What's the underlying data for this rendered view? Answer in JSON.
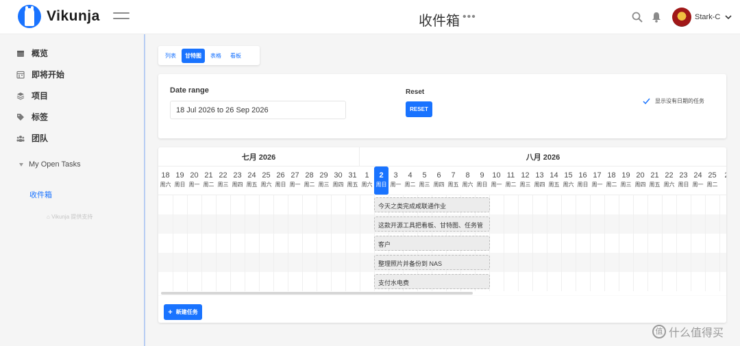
{
  "app": {
    "name": "Vikunja"
  },
  "header": {
    "title": "收件箱",
    "menu_dots": "•••",
    "username": "Stark-C"
  },
  "sidebar": {
    "items": [
      {
        "label": "概览",
        "icon": "calendar-icon"
      },
      {
        "label": "即将开始",
        "icon": "calendar-grid-icon"
      },
      {
        "label": "项目",
        "icon": "layers-icon"
      },
      {
        "label": "标签",
        "icon": "tags-icon"
      },
      {
        "label": "团队",
        "icon": "users-icon"
      }
    ],
    "project": "My Open Tasks",
    "inbox": "收件箱",
    "powered_by": "Vikunja 提供支持"
  },
  "views": {
    "tabs": [
      {
        "label": "列表",
        "active": false
      },
      {
        "label": "甘特图",
        "active": true
      },
      {
        "label": "表格",
        "active": false
      },
      {
        "label": "看板",
        "active": false
      }
    ]
  },
  "options": {
    "date_range_label": "Date range",
    "date_range_value": "18 Jul 2026 to 26 Sep 2026",
    "reset_label": "Reset",
    "reset_button": "RESET",
    "show_undated_label": "显示没有日期的任务"
  },
  "gantt": {
    "months": [
      "七月 2026",
      "八月 2026"
    ],
    "today_index": 15,
    "days": [
      {
        "num": "18",
        "wd": "周六"
      },
      {
        "num": "19",
        "wd": "周日"
      },
      {
        "num": "20",
        "wd": "周一"
      },
      {
        "num": "21",
        "wd": "周二"
      },
      {
        "num": "22",
        "wd": "周三"
      },
      {
        "num": "23",
        "wd": "周四"
      },
      {
        "num": "24",
        "wd": "周五"
      },
      {
        "num": "25",
        "wd": "周六"
      },
      {
        "num": "26",
        "wd": "周日"
      },
      {
        "num": "27",
        "wd": "周一"
      },
      {
        "num": "28",
        "wd": "周二"
      },
      {
        "num": "29",
        "wd": "周三"
      },
      {
        "num": "30",
        "wd": "周四"
      },
      {
        "num": "31",
        "wd": "周五"
      },
      {
        "num": "1",
        "wd": "周六"
      },
      {
        "num": "2",
        "wd": "周日"
      },
      {
        "num": "3",
        "wd": "周一"
      },
      {
        "num": "4",
        "wd": "周二"
      },
      {
        "num": "5",
        "wd": "周三"
      },
      {
        "num": "6",
        "wd": "周四"
      },
      {
        "num": "7",
        "wd": "周五"
      },
      {
        "num": "8",
        "wd": "周六"
      },
      {
        "num": "9",
        "wd": "周日"
      },
      {
        "num": "10",
        "wd": "周一"
      },
      {
        "num": "11",
        "wd": "周二"
      },
      {
        "num": "12",
        "wd": "周三"
      },
      {
        "num": "13",
        "wd": "周四"
      },
      {
        "num": "14",
        "wd": "周五"
      },
      {
        "num": "15",
        "wd": "周六"
      },
      {
        "num": "16",
        "wd": "周日"
      },
      {
        "num": "17",
        "wd": "周一"
      },
      {
        "num": "18",
        "wd": "周二"
      },
      {
        "num": "19",
        "wd": "周三"
      },
      {
        "num": "20",
        "wd": "周四"
      },
      {
        "num": "21",
        "wd": "周五"
      },
      {
        "num": "22",
        "wd": "周六"
      },
      {
        "num": "23",
        "wd": "周日"
      },
      {
        "num": "24",
        "wd": "周一"
      },
      {
        "num": "25",
        "wd": "周二"
      },
      {
        "num": "2",
        "wd": ""
      }
    ],
    "tasks": [
      "今天之类完成咸联通作业",
      "这款开源工具把看板、甘特图、任务管",
      "客户",
      "整理照片并备份到 NAS",
      "支付水电费"
    ]
  },
  "footer": {
    "new_task": "新建任务"
  },
  "watermark": {
    "text": "什么值得买",
    "logo": "值"
  },
  "colors": {
    "accent": "#1973ff",
    "sidebar_border": "#b7cdf3"
  }
}
